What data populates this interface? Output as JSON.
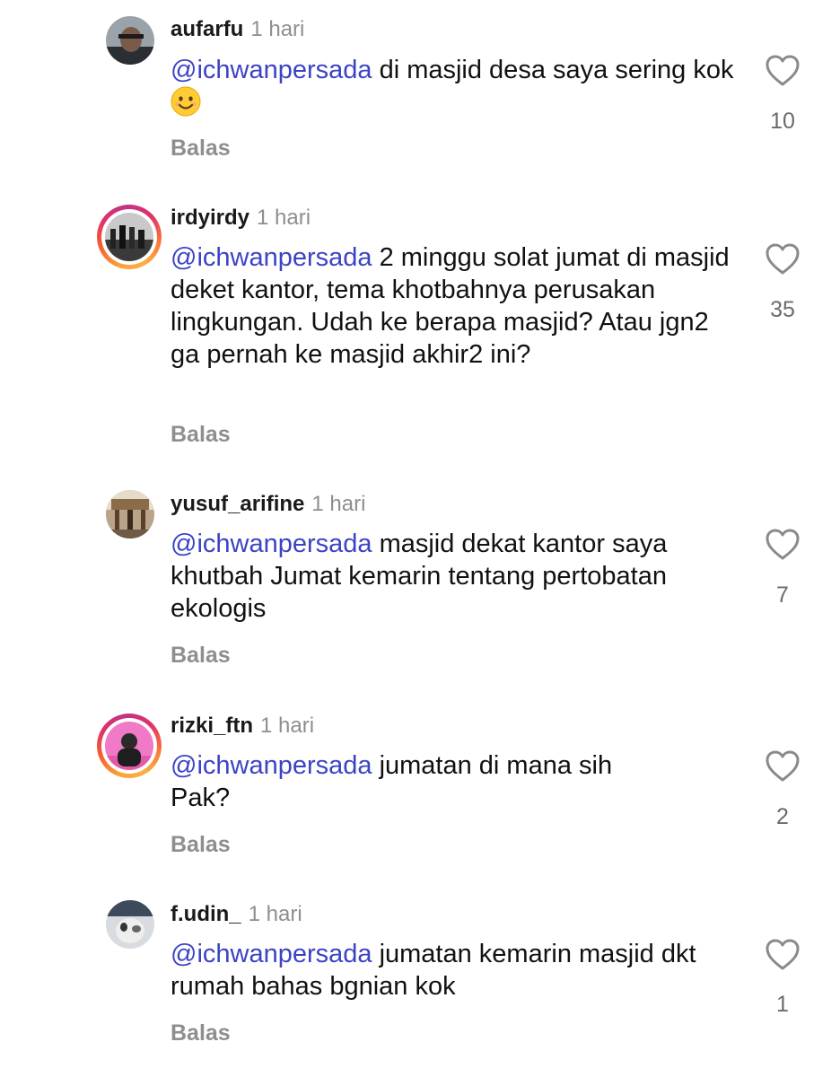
{
  "comments": [
    {
      "username": "aufarfu",
      "time": "1 hari",
      "mention": "@ichwanpersada",
      "text": " di masjid desa saya sering kok ",
      "emoji": "smiling-face-emoji",
      "reply_label": "Balas",
      "likes": "10",
      "avatar_ring": false
    },
    {
      "username": "irdyirdy",
      "time": "1 hari",
      "mention": "@ichwanpersada",
      "text": " 2 minggu solat jumat di masjid deket kantor, tema khotbahnya perusakan lingkungan. Udah ke berapa masjid? Atau jgn2 ga pernah ke masjid akhir2 ini?",
      "reply_label": "Balas",
      "likes": "35",
      "avatar_ring": true
    },
    {
      "username": "yusuf_arifine",
      "time": "1 hari",
      "mention": "@ichwanpersada",
      "text": " masjid dekat kantor saya khutbah Jumat kemarin tentang pertobatan ekologis",
      "reply_label": "Balas",
      "likes": "7",
      "avatar_ring": false
    },
    {
      "username": "rizki_ftn",
      "time": "1 hari",
      "mention": "@ichwanpersada",
      "text": " jumatan di mana sih Pak?",
      "reply_label": "Balas",
      "likes": "2",
      "avatar_ring": true
    },
    {
      "username": "f.udin_",
      "time": "1 hari",
      "mention": "@ichwanpersada",
      "text": " jumatan kemarin masjid dkt rumah bahas bgnian kok",
      "reply_label": "Balas",
      "likes": "1",
      "avatar_ring": false
    }
  ],
  "icons": {
    "like": "heart-outline-icon"
  },
  "colors": {
    "mention": "#3c43c4",
    "meta": "#8e8e8e",
    "text": "#111111"
  }
}
